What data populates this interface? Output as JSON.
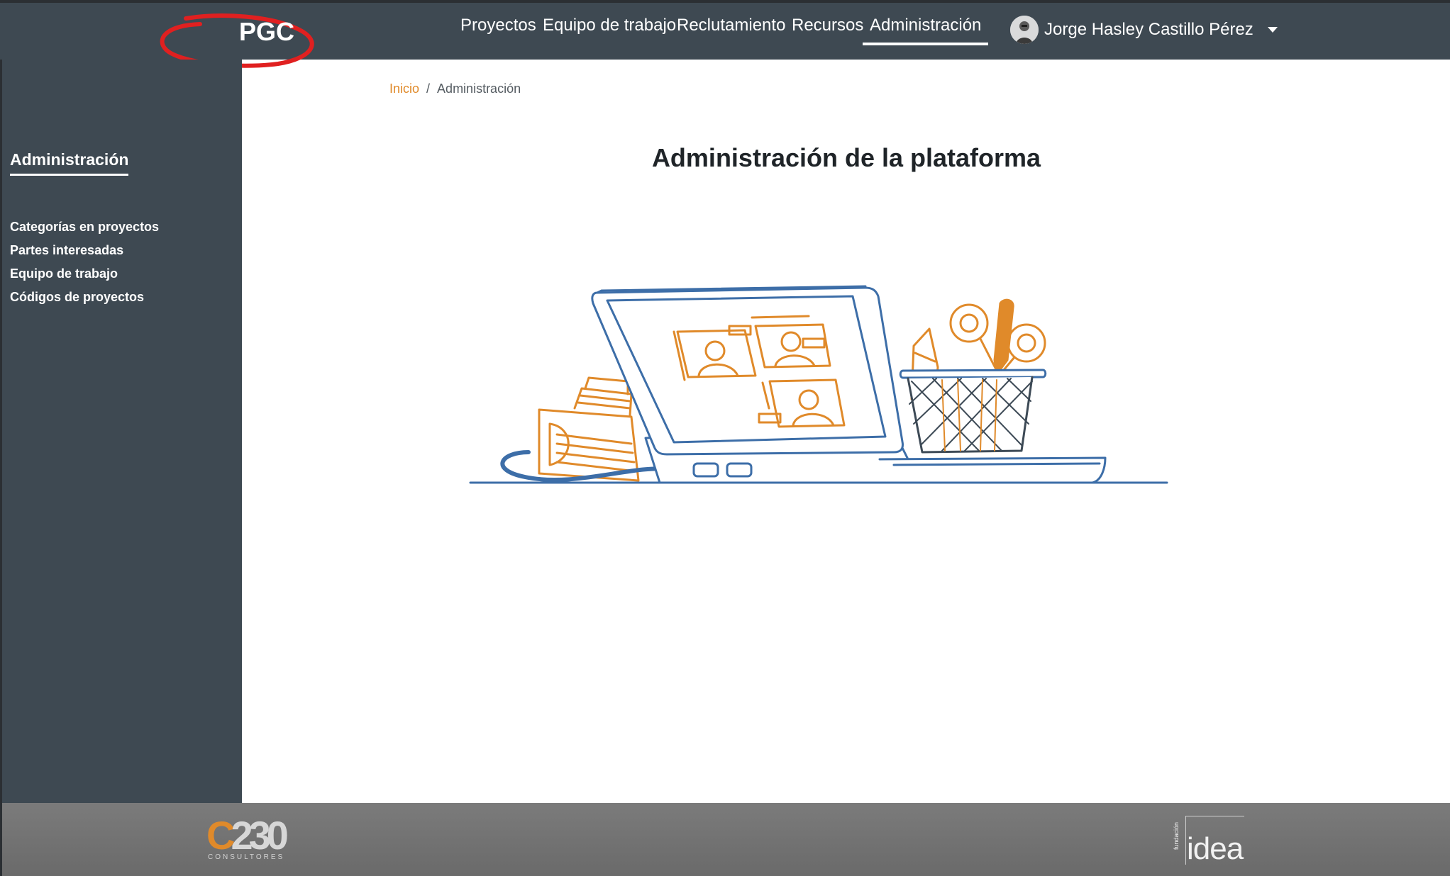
{
  "header": {
    "brand": "PGC",
    "nav": [
      {
        "label": "Proyectos",
        "active": false
      },
      {
        "label": "Equipo de trabajo",
        "active": false
      },
      {
        "label": "Reclutamiento",
        "active": false
      },
      {
        "label": "Recursos",
        "active": false
      },
      {
        "label": "Administración",
        "active": true
      }
    ],
    "user_name": "Jorge Hasley Castillo Pérez"
  },
  "sidebar": {
    "title": "Administración",
    "items": [
      {
        "label": "Categorías en proyectos"
      },
      {
        "label": "Partes interesadas"
      },
      {
        "label": "Equipo de trabajo"
      },
      {
        "label": "Códigos de proyectos"
      }
    ]
  },
  "breadcrumb": {
    "home": "Inicio",
    "separator": "/",
    "current": "Administración"
  },
  "main": {
    "title": "Administración de la plataforma"
  },
  "footer": {
    "left_logo_number": "C230",
    "left_logo_sub": "CONSULTORES",
    "right_logo_word": "idea",
    "right_logo_vertical": "fundación"
  },
  "colors": {
    "header_bg": "#3e4952",
    "accent_orange": "#e08a2a",
    "illustration_blue": "#3d6ea8",
    "annotation_red": "#e02020"
  }
}
